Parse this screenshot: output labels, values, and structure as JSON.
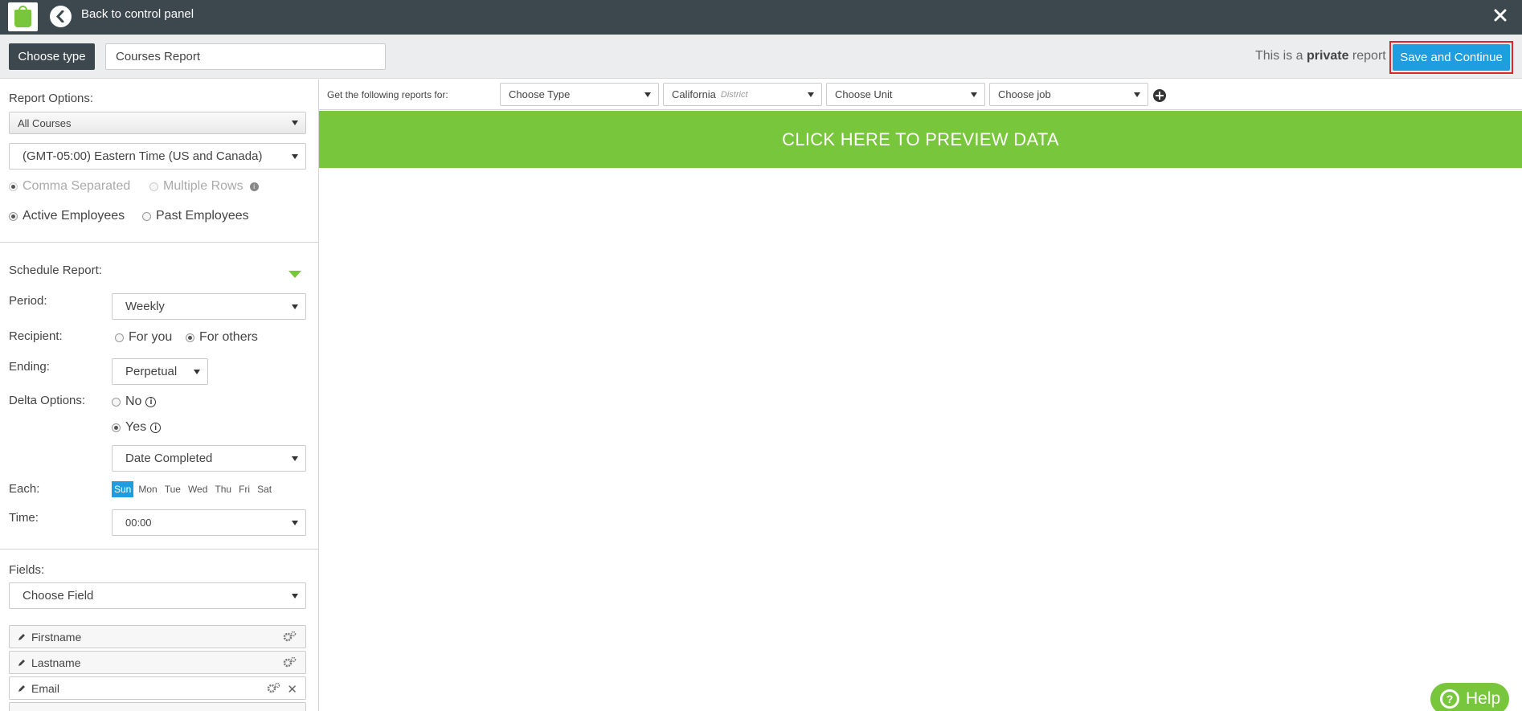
{
  "topbar": {
    "back_label": "Back to control panel"
  },
  "subbar": {
    "choose_type": "Choose type",
    "report_name": "Courses Report",
    "private_prefix": "This is a ",
    "private_word": "private",
    "private_suffix": " report",
    "save_label": "Save and Continue"
  },
  "left": {
    "report_options_label": "Report Options:",
    "courses_select": "All Courses",
    "timezone_select": "(GMT-05:00) Eastern Time (US and Canada)",
    "comma_separated": "Comma Separated",
    "multiple_rows": "Multiple Rows",
    "info_glyph": "i",
    "active_employees": "Active Employees",
    "past_employees": "Past Employees",
    "schedule_label": "Schedule Report:",
    "period_label": "Period:",
    "period_value": "Weekly",
    "recipient_label": "Recipient:",
    "for_you": "For you",
    "for_others": "For others",
    "ending_label": "Ending:",
    "ending_value": "Perpetual",
    "delta_label": "Delta Options:",
    "delta_no": "No",
    "delta_yes": "Yes",
    "delta_select": "Date Completed",
    "each_label": "Each:",
    "days": [
      "Sun",
      "Mon",
      "Tue",
      "Wed",
      "Thu",
      "Fri",
      "Sat"
    ],
    "active_day": "Sun",
    "time_label": "Time:",
    "time_value": "00:00",
    "fields_label": "Fields:",
    "choose_field": "Choose Field",
    "field_items": [
      "Firstname",
      "Lastname",
      "Email"
    ],
    "remove_glyph": "✕"
  },
  "filters": {
    "label": "Get the following reports for:",
    "choose_type": "Choose Type",
    "district_value": "California",
    "district_hint": "District",
    "choose_unit": "Choose Unit",
    "choose_job": "Choose job"
  },
  "preview": {
    "label": "CLICK HERE TO PREVIEW DATA"
  },
  "help": {
    "label": "Help",
    "glyph": "?"
  },
  "colors": {
    "topbar": "#3c474e",
    "accent_green": "#78c63c",
    "accent_blue": "#1e9de0",
    "highlight_red": "#e0252a"
  }
}
